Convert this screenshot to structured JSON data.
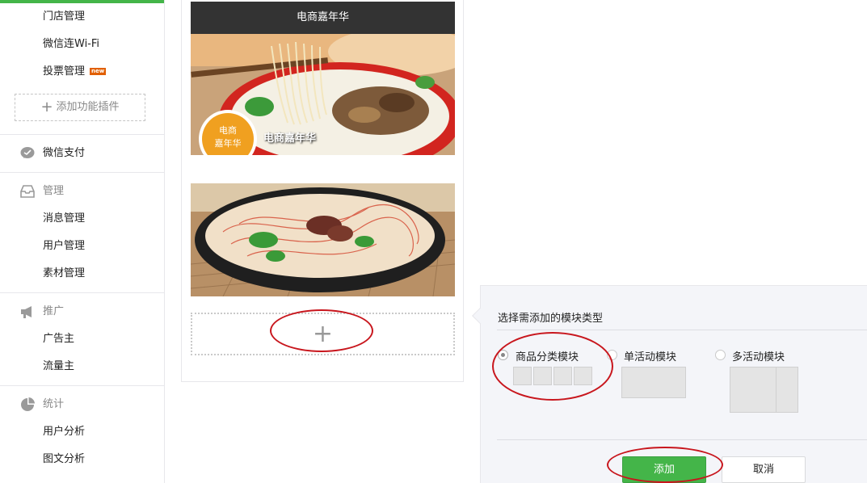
{
  "sidebar": {
    "store_management": "门店管理",
    "wechat_wifi": "微信连Wi-Fi",
    "vote_management": "投票管理",
    "new_badge": "new",
    "add_plugin": "添加功能插件",
    "wechat_pay": "微信支付",
    "manage_head": "管理",
    "message_management": "消息管理",
    "user_management": "用户管理",
    "material_management": "素材管理",
    "promotion_head": "推广",
    "advertiser": "广告主",
    "traffic_owner": "流量主",
    "stats_head": "统计",
    "user_analysis": "用户分析",
    "article_analysis": "图文分析"
  },
  "preview": {
    "banner_title": "电商嘉年华",
    "image1_caption": "电商嘉年华",
    "badge_text_1": "电商",
    "badge_text_2": "嘉年华",
    "add_symbol": "+"
  },
  "popover": {
    "title": "选择需添加的模块类型",
    "options": [
      {
        "label": "商品分类模块",
        "selected": true
      },
      {
        "label": "单活动模块",
        "selected": false
      },
      {
        "label": "多活动模块",
        "selected": false
      }
    ],
    "add_button": "添加",
    "cancel_button": "取消"
  },
  "colors": {
    "accent_green": "#44b549",
    "annotation_red": "#c8161d",
    "banner_dark": "#333333"
  }
}
